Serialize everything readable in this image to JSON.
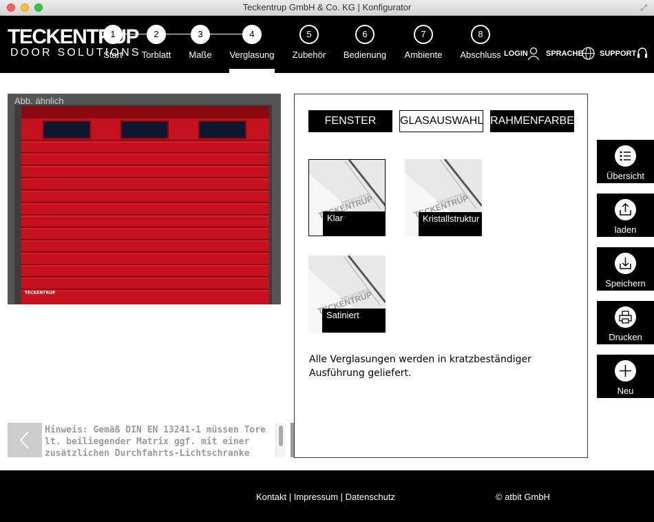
{
  "window": {
    "title": "Teckentrup GmbH & Co. KG | Konfigurator"
  },
  "brand": {
    "line1": "TECKENTRUP",
    "line2": "DOOR SOLUTIONS"
  },
  "steps": [
    {
      "num": "1",
      "label": "Start"
    },
    {
      "num": "2",
      "label": "Torblatt"
    },
    {
      "num": "3",
      "label": "Maße"
    },
    {
      "num": "4",
      "label": "Verglasung"
    },
    {
      "num": "5",
      "label": "Zubehör"
    },
    {
      "num": "6",
      "label": "Bedienung"
    },
    {
      "num": "7",
      "label": "Ambiente"
    },
    {
      "num": "8",
      "label": "Abschluss"
    }
  ],
  "header_links": {
    "login": "LOGIN",
    "language": "SPRACHE",
    "support": "SUPPORT"
  },
  "preview": {
    "caption": "Abb. ähnlich",
    "mini_logo": "TECKENTRUP"
  },
  "hint": {
    "text": "Hinweis: Gemäß DIN EN 13241-1 müssen Tore lt. beiliegender Matrix ggf. mit einer zusätzlichen Durchfahrts-Lichtschranke"
  },
  "tabs": {
    "window": "FENSTER",
    "glass": "GLASAUSWAHL",
    "frame": "RAHMENFARBE"
  },
  "options": [
    {
      "label": "Klar"
    },
    {
      "label": "Kristallstruktur"
    },
    {
      "label": "Satiniert"
    }
  ],
  "option_watermark": {
    "brand": "TECKENTRUP",
    "sub": "SOLUTIONS"
  },
  "note": "Alle Verglasungen werden in kratzbeständiger Ausführung geliefert.",
  "side": {
    "overview": "Übersicht",
    "load": "laden",
    "save": "Speichern",
    "print": "Drucken",
    "new": "Neu"
  },
  "footer": {
    "contact": "Kontakt",
    "imprint": "Impressum",
    "privacy": "Datenschutz",
    "sep": "|",
    "copyright": "© atbit GmbH"
  },
  "colors": {
    "door_red": "#c5101e",
    "header_bg": "#000000"
  }
}
